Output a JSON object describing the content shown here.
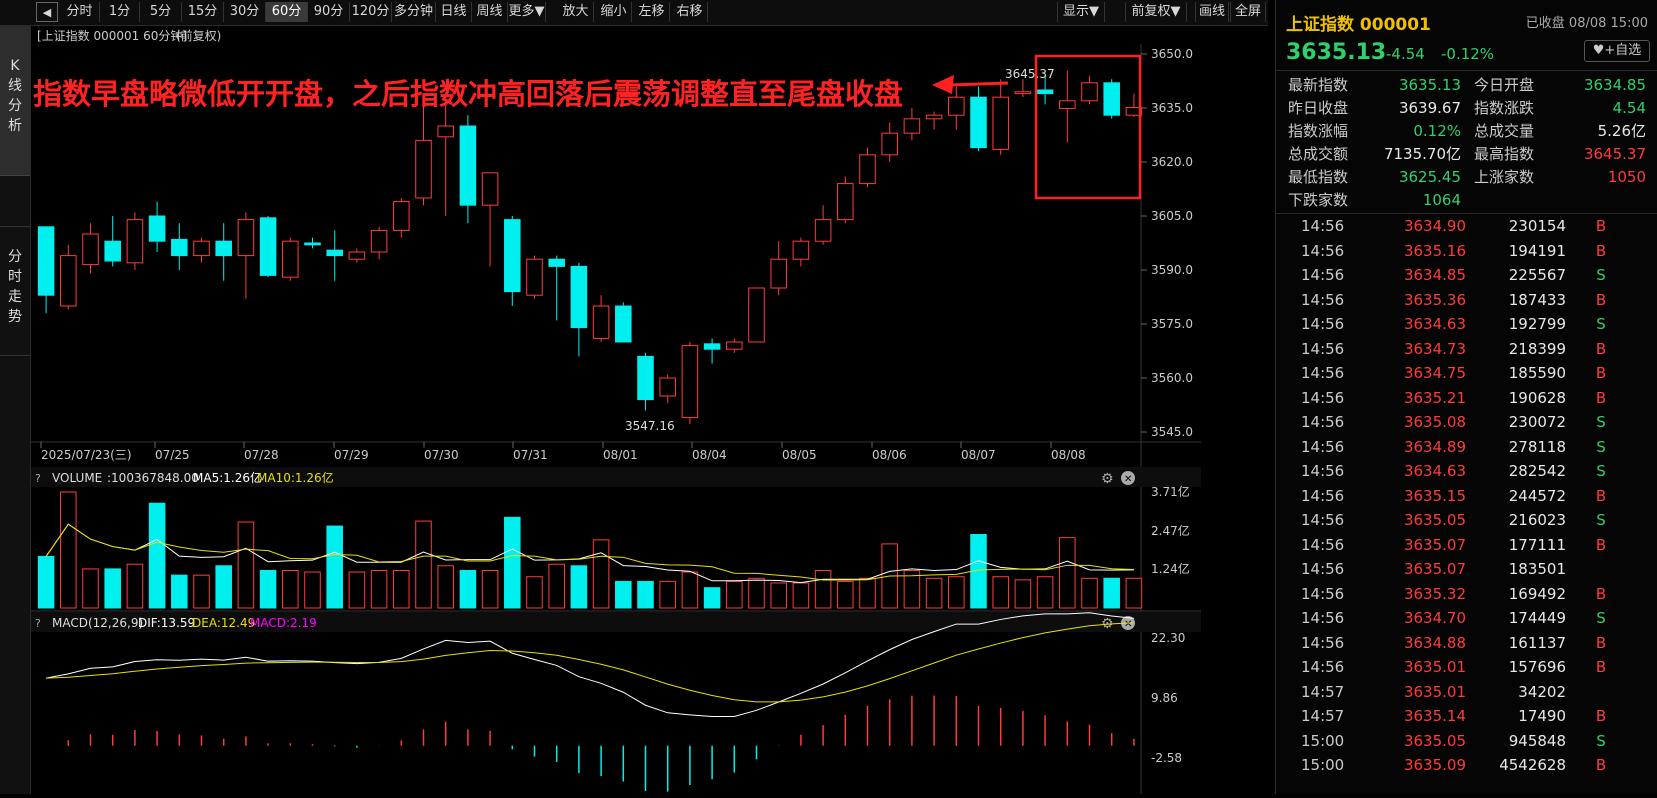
{
  "toolbar": {
    "back_icon": "back-arrow-icon",
    "periods": [
      "分时",
      "1分",
      "5分",
      "15分",
      "30分",
      "60分",
      "90分",
      "120分",
      "多分钟",
      "日线",
      "周线",
      "更多▼"
    ],
    "active_period": "60分",
    "actions": [
      "放大",
      "缩小",
      "左移",
      "右移"
    ],
    "right_actions": [
      "显示▼",
      "前复权▼",
      "画线",
      "全屏"
    ]
  },
  "leftnav": {
    "kline": "K线分析",
    "timeshare": "分时走势"
  },
  "chart": {
    "header": "[上证指数 000001 60分钟]",
    "header_adj": "(前复权)",
    "annotation": "指数早盘略微低开开盘，之后指数冲高回落后震荡调整直至尾盘收盘",
    "high_label": "3645.37",
    "low_label": "3547.16",
    "volume_header": {
      "name": "VOLUME",
      "value": ":100367848.00",
      "ma5": "MA5:1.26亿",
      "ma10": "MA10:1.26亿"
    },
    "macd_header": {
      "name": "MACD(12,26,9)",
      "dif": "DIF:13.59",
      "dea": "DEA:12.49",
      "macd": "MACD:2.19"
    },
    "colors": {
      "up": "#ff3b3b",
      "down": "#00f0f0",
      "ma5": "#ffffff",
      "ma10": "#e8e000",
      "macd": "#ff00ff"
    }
  },
  "chart_data": [
    {
      "type": "candlestick",
      "title": "上证指数 000001 60分钟",
      "x_labels": [
        "2025/07/23(三)",
        "07/25",
        "07/28",
        "07/29",
        "07/30",
        "07/31",
        "08/01",
        "08/04",
        "08/05",
        "08/06",
        "08/07",
        "08/08"
      ],
      "y_ticks": [
        "3650.0",
        "3635.0",
        "3620.0",
        "3605.0",
        "3590.0",
        "3575.0",
        "3560.0",
        "3545.0"
      ],
      "ylim": [
        3545,
        3650
      ],
      "candles": [
        {
          "o": 3602.0,
          "h": 3593.0,
          "l": 3578.0,
          "c": 3583.0
        },
        {
          "o": 3580.0,
          "h": 3597.0,
          "l": 3579.0,
          "c": 3594.0
        },
        {
          "o": 3591.5,
          "h": 3603.0,
          "l": 3589.0,
          "c": 3600.0
        },
        {
          "o": 3598.0,
          "h": 3605.0,
          "l": 3591.0,
          "c": 3592.5
        },
        {
          "o": 3592.0,
          "h": 3606.0,
          "l": 3590.0,
          "c": 3604.0
        },
        {
          "o": 3605.0,
          "h": 3609.0,
          "l": 3595.0,
          "c": 3598.0
        },
        {
          "o": 3598.5,
          "h": 3603.0,
          "l": 3590.0,
          "c": 3594.0
        },
        {
          "o": 3594.0,
          "h": 3599.0,
          "l": 3592.0,
          "c": 3598.0
        },
        {
          "o": 3598.0,
          "h": 3603.0,
          "l": 3587.0,
          "c": 3594.0
        },
        {
          "o": 3594.0,
          "h": 3606.0,
          "l": 3582.0,
          "c": 3604.0
        },
        {
          "o": 3604.5,
          "h": 3605.0,
          "l": 3588.0,
          "c": 3588.5
        },
        {
          "o": 3588.0,
          "h": 3599.0,
          "l": 3587.0,
          "c": 3598.0
        },
        {
          "o": 3597.5,
          "h": 3599.0,
          "l": 3596.0,
          "c": 3597.0
        },
        {
          "o": 3595.5,
          "h": 3601.0,
          "l": 3587.0,
          "c": 3594.0
        },
        {
          "o": 3593.0,
          "h": 3596.0,
          "l": 3592.0,
          "c": 3595.0
        },
        {
          "o": 3595.0,
          "h": 3602.0,
          "l": 3593.0,
          "c": 3601.0
        },
        {
          "o": 3601.0,
          "h": 3610.0,
          "l": 3599.0,
          "c": 3609.0
        },
        {
          "o": 3610.0,
          "h": 3637.0,
          "l": 3608.0,
          "c": 3626.0
        },
        {
          "o": 3627.0,
          "h": 3637.0,
          "l": 3605.0,
          "c": 3630.0
        },
        {
          "o": 3630.0,
          "h": 3633.0,
          "l": 3603.0,
          "c": 3608.0
        },
        {
          "o": 3608.0,
          "h": 3617.0,
          "l": 3591.0,
          "c": 3617.0
        },
        {
          "o": 3604.0,
          "h": 3605.0,
          "l": 3580.0,
          "c": 3584.0
        },
        {
          "o": 3583.0,
          "h": 3594.0,
          "l": 3582.0,
          "c": 3593.0
        },
        {
          "o": 3593.0,
          "h": 3594.0,
          "l": 3576.0,
          "c": 3591.0
        },
        {
          "o": 3591.0,
          "h": 3592.0,
          "l": 3566.0,
          "c": 3574.0
        },
        {
          "o": 3571.0,
          "h": 3583.0,
          "l": 3570.0,
          "c": 3580.0
        },
        {
          "o": 3580.0,
          "h": 3581.0,
          "l": 3571.0,
          "c": 3570.0
        },
        {
          "o": 3566.0,
          "h": 3567.0,
          "l": 3551.0,
          "c": 3554.0
        },
        {
          "o": 3555.0,
          "h": 3561.0,
          "l": 3553.0,
          "c": 3560.0
        },
        {
          "o": 3549.0,
          "h": 3570.0,
          "l": 3547.16,
          "c": 3569.0
        },
        {
          "o": 3569.5,
          "h": 3571.0,
          "l": 3564.0,
          "c": 3568.0
        },
        {
          "o": 3568.0,
          "h": 3571.0,
          "l": 3567.0,
          "c": 3570.0
        },
        {
          "o": 3570.0,
          "h": 3585.0,
          "l": 3570.0,
          "c": 3585.0
        },
        {
          "o": 3585.0,
          "h": 3598.0,
          "l": 3583.0,
          "c": 3593.0
        },
        {
          "o": 3593.0,
          "h": 3599.0,
          "l": 3591.0,
          "c": 3598.0
        },
        {
          "o": 3598.0,
          "h": 3608.0,
          "l": 3597.0,
          "c": 3604.0
        },
        {
          "o": 3604.0,
          "h": 3616.0,
          "l": 3603.0,
          "c": 3614.0
        },
        {
          "o": 3614.0,
          "h": 3624.0,
          "l": 3613.0,
          "c": 3622.0
        },
        {
          "o": 3622.0,
          "h": 3631.0,
          "l": 3620.0,
          "c": 3628.0
        },
        {
          "o": 3628.0,
          "h": 3635.0,
          "l": 3626.0,
          "c": 3632.0
        },
        {
          "o": 3632.0,
          "h": 3634.0,
          "l": 3629.0,
          "c": 3633.0
        },
        {
          "o": 3633.0,
          "h": 3641.0,
          "l": 3629.0,
          "c": 3638.0
        },
        {
          "o": 3638.0,
          "h": 3641.0,
          "l": 3623.0,
          "c": 3624.0
        },
        {
          "o": 3623.5,
          "h": 3643.0,
          "l": 3622.0,
          "c": 3638.0
        },
        {
          "o": 3639.0,
          "h": 3643.0,
          "l": 3638.0,
          "c": 3639.5
        },
        {
          "o": 3640.0,
          "h": 3644.0,
          "l": 3636.0,
          "c": 3639.0
        },
        {
          "o": 3634.85,
          "h": 3645.37,
          "l": 3625.45,
          "c": 3637.0
        },
        {
          "o": 3637.0,
          "h": 3644.0,
          "l": 3636.0,
          "c": 3642.0
        },
        {
          "o": 3642.0,
          "h": 3643.0,
          "l": 3632.0,
          "c": 3633.0
        },
        {
          "o": 3633.0,
          "h": 3639.0,
          "l": 3632.5,
          "c": 3635.13
        }
      ]
    },
    {
      "type": "bar",
      "title": "VOLUME",
      "y_ticks": [
        "3.71亿",
        "2.47亿",
        "1.24亿"
      ],
      "unit": "亿",
      "values": [
        1.65,
        3.71,
        1.25,
        1.25,
        1.4,
        3.35,
        1.05,
        1.05,
        1.35,
        2.75,
        1.2,
        1.2,
        1.15,
        2.62,
        1.15,
        1.2,
        1.2,
        2.78,
        1.35,
        1.2,
        1.2,
        2.9,
        1.0,
        1.4,
        1.35,
        2.18,
        0.85,
        0.85,
        0.85,
        1.15,
        0.65,
        0.85,
        0.95,
        0.8,
        0.8,
        1.2,
        0.85,
        0.95,
        2.05,
        1.2,
        0.95,
        1.0,
        2.35,
        1.0,
        0.9,
        1.0,
        2.25,
        0.95,
        0.95,
        0.95
      ],
      "up": [
        false,
        true,
        true,
        false,
        true,
        false,
        false,
        true,
        false,
        true,
        false,
        true,
        true,
        false,
        true,
        true,
        true,
        true,
        true,
        false,
        true,
        false,
        true,
        true,
        false,
        true,
        false,
        false,
        true,
        true,
        false,
        true,
        true,
        true,
        true,
        true,
        true,
        true,
        true,
        true,
        true,
        true,
        false,
        true,
        true,
        true,
        true,
        true,
        false,
        true
      ]
    },
    {
      "type": "bar",
      "title": "MACD(12,26,9)",
      "y_ticks": [
        "22.30",
        "9.86",
        "-2.58"
      ]
    }
  ],
  "right_panel": {
    "title": "上证指数 000001",
    "status": "已收盘 08/08 15:00",
    "price": "3635.13",
    "change": "-4.54",
    "change_pct": "-0.12%",
    "fav_label": "+自选",
    "stats": [
      {
        "l1": "最新指数",
        "v1": "3635.13",
        "c1": "green",
        "l2": "今日开盘",
        "v2": "3634.85",
        "c2": "green"
      },
      {
        "l1": "昨日收盘",
        "v1": "3639.67",
        "c1": "white",
        "l2": "指数涨跌",
        "v2": "4.54",
        "c2": "green"
      },
      {
        "l1": "指数涨幅",
        "v1": "0.12%",
        "c1": "green",
        "l2": "总成交量",
        "v2": "5.26亿",
        "c2": "white"
      },
      {
        "l1": "总成交额",
        "v1": "7135.70亿",
        "c1": "white",
        "l2": "最高指数",
        "v2": "3645.37",
        "c2": "red"
      },
      {
        "l1": "最低指数",
        "v1": "3625.45",
        "c1": "green",
        "l2": "上涨家数",
        "v2": "1050",
        "c2": "red"
      },
      {
        "l1": "下跌家数",
        "v1": "1064",
        "c1": "green",
        "l2": "",
        "v2": "",
        "c2": "white"
      }
    ],
    "ticks": [
      {
        "t": "14:56",
        "p": "3634.90",
        "v": "230154",
        "d": "B"
      },
      {
        "t": "14:56",
        "p": "3635.16",
        "v": "194191",
        "d": "B"
      },
      {
        "t": "14:56",
        "p": "3634.85",
        "v": "225567",
        "d": "S"
      },
      {
        "t": "14:56",
        "p": "3635.36",
        "v": "187433",
        "d": "B"
      },
      {
        "t": "14:56",
        "p": "3634.63",
        "v": "192799",
        "d": "S"
      },
      {
        "t": "14:56",
        "p": "3634.73",
        "v": "218399",
        "d": "B"
      },
      {
        "t": "14:56",
        "p": "3634.75",
        "v": "185590",
        "d": "B"
      },
      {
        "t": "14:56",
        "p": "3635.21",
        "v": "190628",
        "d": "B"
      },
      {
        "t": "14:56",
        "p": "3635.08",
        "v": "230072",
        "d": "S"
      },
      {
        "t": "14:56",
        "p": "3634.89",
        "v": "278118",
        "d": "S"
      },
      {
        "t": "14:56",
        "p": "3634.63",
        "v": "282542",
        "d": "S"
      },
      {
        "t": "14:56",
        "p": "3635.15",
        "v": "244572",
        "d": "B"
      },
      {
        "t": "14:56",
        "p": "3635.05",
        "v": "216023",
        "d": "S"
      },
      {
        "t": "14:56",
        "p": "3635.07",
        "v": "177111",
        "d": "B"
      },
      {
        "t": "14:56",
        "p": "3635.07",
        "v": "183501",
        "d": ""
      },
      {
        "t": "14:56",
        "p": "3635.32",
        "v": "169492",
        "d": "B"
      },
      {
        "t": "14:56",
        "p": "3634.70",
        "v": "174449",
        "d": "S"
      },
      {
        "t": "14:56",
        "p": "3634.88",
        "v": "161137",
        "d": "B"
      },
      {
        "t": "14:56",
        "p": "3635.01",
        "v": "157696",
        "d": "B"
      },
      {
        "t": "14:57",
        "p": "3635.01",
        "v": "34202",
        "d": ""
      },
      {
        "t": "14:57",
        "p": "3635.14",
        "v": "17490",
        "d": "B"
      },
      {
        "t": "15:00",
        "p": "3635.05",
        "v": "945848",
        "d": "S"
      },
      {
        "t": "15:00",
        "p": "3635.09",
        "v": "4542628",
        "d": "B"
      }
    ]
  }
}
